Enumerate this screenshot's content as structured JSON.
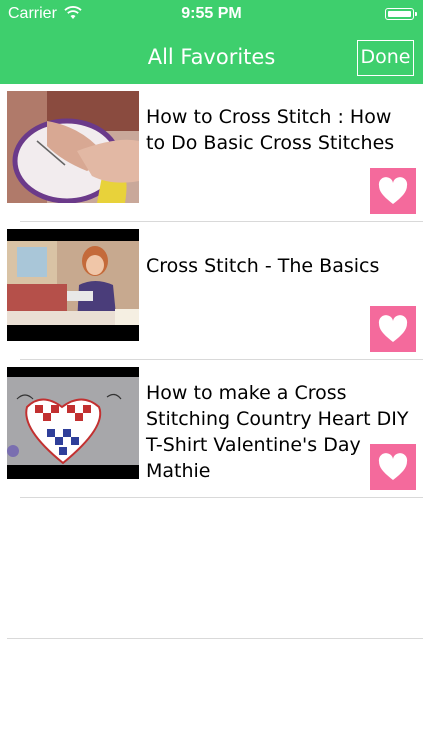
{
  "status_bar": {
    "carrier": "Carrier",
    "time": "9:55 PM",
    "wifi_icon": "wifi-icon",
    "battery_icon": "battery-icon"
  },
  "nav": {
    "title": "All Favorites",
    "done_label": "Done"
  },
  "colors": {
    "nav_green": "#3ecf6d",
    "favorite_pink": "#f46a9c"
  },
  "items": [
    {
      "title": "How to Cross Stitch : How to Do Basic Cross Stitches",
      "favorite_icon": "heart-icon"
    },
    {
      "title": "Cross Stitch - The Basics",
      "favorite_icon": "heart-icon"
    },
    {
      "title": "How to make a Cross Stitching Country Heart DIY T-Shirt Valentine's Day Mathie",
      "favorite_icon": "heart-icon"
    }
  ]
}
